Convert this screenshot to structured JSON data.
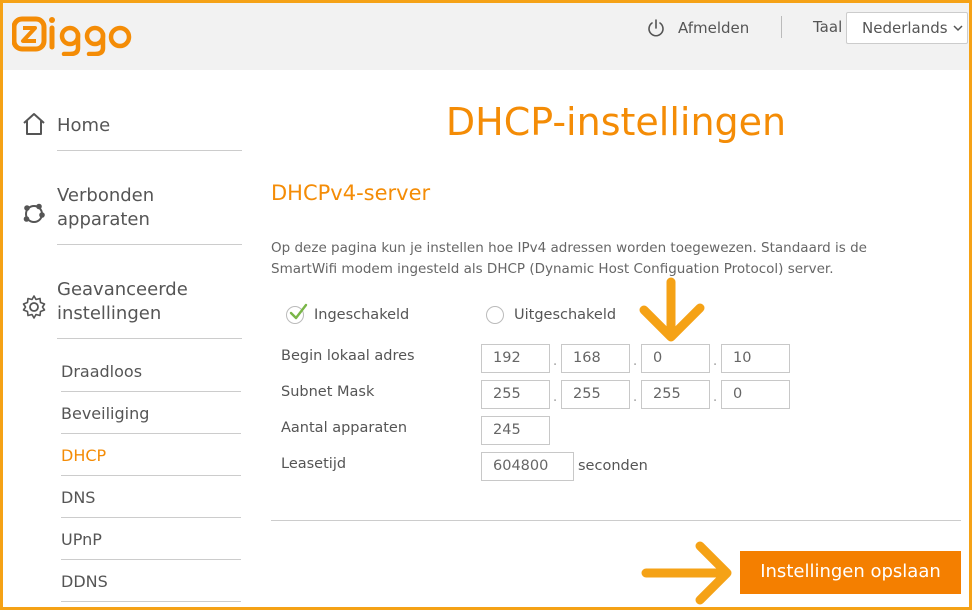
{
  "brand": {
    "logo_text": "ziggo",
    "accent_color": "#f48c06",
    "annotation_color": "#f5a216"
  },
  "header": {
    "logout_label": "Afmelden",
    "language_label": "Taal",
    "language_selected": "Nederlands"
  },
  "sidebar": {
    "main_items": [
      {
        "label": "Home",
        "icon": "home-icon"
      },
      {
        "label_line1": "Verbonden",
        "label_line2": "apparaten",
        "icon": "connected-devices-icon"
      },
      {
        "label_line1": "Geavanceerde",
        "label_line2": "instellingen",
        "icon": "gear-icon"
      }
    ],
    "sub_items": [
      {
        "label": "Draadloos",
        "active": false
      },
      {
        "label": "Beveiliging",
        "active": false
      },
      {
        "label": "DHCP",
        "active": true
      },
      {
        "label": "DNS",
        "active": false
      },
      {
        "label": "UPnP",
        "active": false
      },
      {
        "label": "DDNS",
        "active": false
      }
    ]
  },
  "main": {
    "title": "DHCP-instellingen",
    "section_title": "DHCPv4-server",
    "description_line1": "Op deze pagina kun je instellen hoe IPv4 adressen worden toegewezen. Standaard is de",
    "description_line2": "SmartWifi modem ingesteld als DHCP (Dynamic Host Configuation Protocol) server.",
    "radio_enabled": {
      "label": "Ingeschakeld",
      "checked": true
    },
    "radio_disabled": {
      "label": "Uitgeschakeld",
      "checked": false
    },
    "begin_address": {
      "label": "Begin lokaal adres",
      "octets": [
        "192",
        "168",
        "0",
        "10"
      ]
    },
    "subnet_mask": {
      "label": "Subnet Mask",
      "octets": [
        "255",
        "255",
        "255",
        "0"
      ]
    },
    "device_count": {
      "label": "Aantal apparaten",
      "value": "245"
    },
    "lease_time": {
      "label": "Leasetijd",
      "value": "604800",
      "unit": "seconden"
    },
    "octet_separator": ".",
    "save_label": "Instellingen opslaan"
  }
}
